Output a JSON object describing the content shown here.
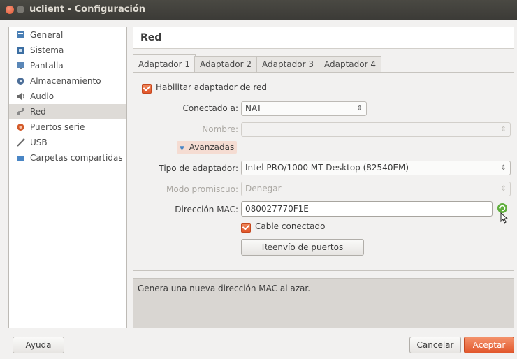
{
  "window": {
    "title": "uclient - Configuración"
  },
  "sidebar": {
    "items": [
      {
        "label": "General",
        "icon": "general-icon"
      },
      {
        "label": "Sistema",
        "icon": "system-icon"
      },
      {
        "label": "Pantalla",
        "icon": "display-icon"
      },
      {
        "label": "Almacenamiento",
        "icon": "storage-icon"
      },
      {
        "label": "Audio",
        "icon": "audio-icon"
      },
      {
        "label": "Red",
        "icon": "network-icon",
        "selected": true
      },
      {
        "label": "Puertos serie",
        "icon": "serial-ports-icon"
      },
      {
        "label": "USB",
        "icon": "usb-icon"
      },
      {
        "label": "Carpetas compartidas",
        "icon": "shared-folders-icon"
      }
    ]
  },
  "header": {
    "title": "Red"
  },
  "tabs": [
    {
      "label": "Adaptador 1",
      "active": true
    },
    {
      "label": "Adaptador 2"
    },
    {
      "label": "Adaptador 3"
    },
    {
      "label": "Adaptador 4"
    }
  ],
  "form": {
    "enable_label": "Habilitar adaptador de red",
    "attached_label": "Conectado a:",
    "attached_value": "NAT",
    "name_label": "Nombre:",
    "name_value": "",
    "advanced_label": "Avanzadas",
    "adapter_type_label": "Tipo de adaptador:",
    "adapter_type_value": "Intel PRO/1000 MT Desktop (82540EM)",
    "promisc_label": "Modo promiscuo:",
    "promisc_value": "Denegar",
    "mac_label": "Dirección MAC:",
    "mac_value": "080027770F1E",
    "cable_label": "Cable conectado",
    "port_forward_label": "Reenvío de puertos"
  },
  "description": "Genera una nueva dirección MAC al azar.",
  "footer": {
    "help": "Ayuda",
    "cancel": "Cancelar",
    "ok": "Aceptar"
  },
  "colors": {
    "accent": "#e2572c",
    "titlebar": "#3c3b37"
  }
}
